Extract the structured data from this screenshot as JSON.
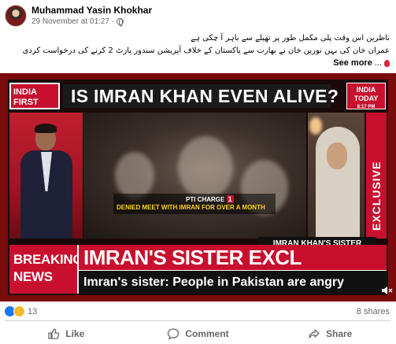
{
  "post": {
    "author": "Muhammad Yasin Khokhar",
    "time": "29 November at 01:27",
    "separator": "·",
    "text_lines": [
      "ناظرین اس وقت پلی مکمل طور پر تھیلے سے باہر آ چکی ہے",
      "عمران خان کی بہن نورین خان نے بھارت سے پاکستان کے خلاف آپریشن سندور پارٹ 2 کرنے کی درخواست کردی"
    ],
    "see_more_dots": "...",
    "see_more": "See more"
  },
  "video": {
    "logo_left": "INDIA FIRST",
    "headline": "IS IMRAN KHAN EVEN ALIVE?",
    "logo_right": "INDIA TODAY",
    "logo_time": "8:17 PM",
    "caption_line1": "PTI CHARGE",
    "caption_num": "1",
    "caption_line2": "DENIED MEET WITH IMRAN FOR OVER A MONTH",
    "center_label": "IMRAN KHAN'S SISTER",
    "exclusive": "EXCLUSIVE",
    "breaking": "BREAKING NEWS",
    "band_title": "IMRAN'S SISTER EXCL",
    "ticker": "Imran's sister: People in Pakistan are angry"
  },
  "stats": {
    "reaction_count": "13",
    "shares": "8 shares"
  },
  "actions": {
    "like": "Like",
    "comment": "Comment",
    "share": "Share"
  },
  "colors": {
    "brand_red": "#c8102e",
    "facebook_blue": "#1877f2",
    "meta_gray": "#65676b"
  }
}
